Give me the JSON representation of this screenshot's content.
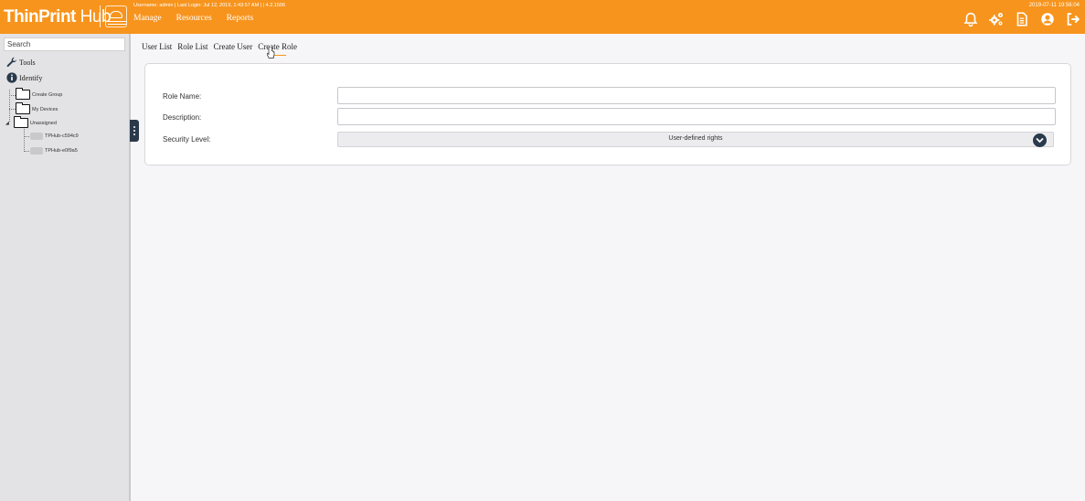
{
  "colors": {
    "accent": "#f7941d",
    "dark": "#2a3a4a",
    "sidebar_bg": "#e3e3e6"
  },
  "header": {
    "brand_bold": "ThinPrint",
    "brand_light": " Hub",
    "user_info": "Username: admin | Last Login: Jul 12, 2019, 1:43:57 AM |  |  4.2.1506",
    "datetime": "2019-07-11 19:56:04",
    "nav": [
      "Manage",
      "Resources",
      "Reports"
    ],
    "icons": [
      "bell-icon",
      "gears-icon",
      "document-icon",
      "user-circle-icon",
      "logout-icon"
    ]
  },
  "sidebar": {
    "search_placeholder": "Search",
    "tools_label": "Tools",
    "identify_label": "Identify",
    "tree": {
      "create_group": "Create Group",
      "my_devices": "My Devices",
      "unassigned": "Unassigned",
      "device_1": "TPHub-c594c9",
      "device_2": "TPHub-e0f9a5"
    }
  },
  "main": {
    "tabs": [
      "User List",
      "Role List",
      "Create User",
      "Create Role"
    ],
    "active_tab": "Create Role",
    "form": {
      "role_name_label": "Role Name:",
      "role_name_value": "",
      "description_label": "Description:",
      "description_value": "",
      "security_level_label": "Security Level:",
      "security_level_value": "User-defined rights"
    }
  }
}
